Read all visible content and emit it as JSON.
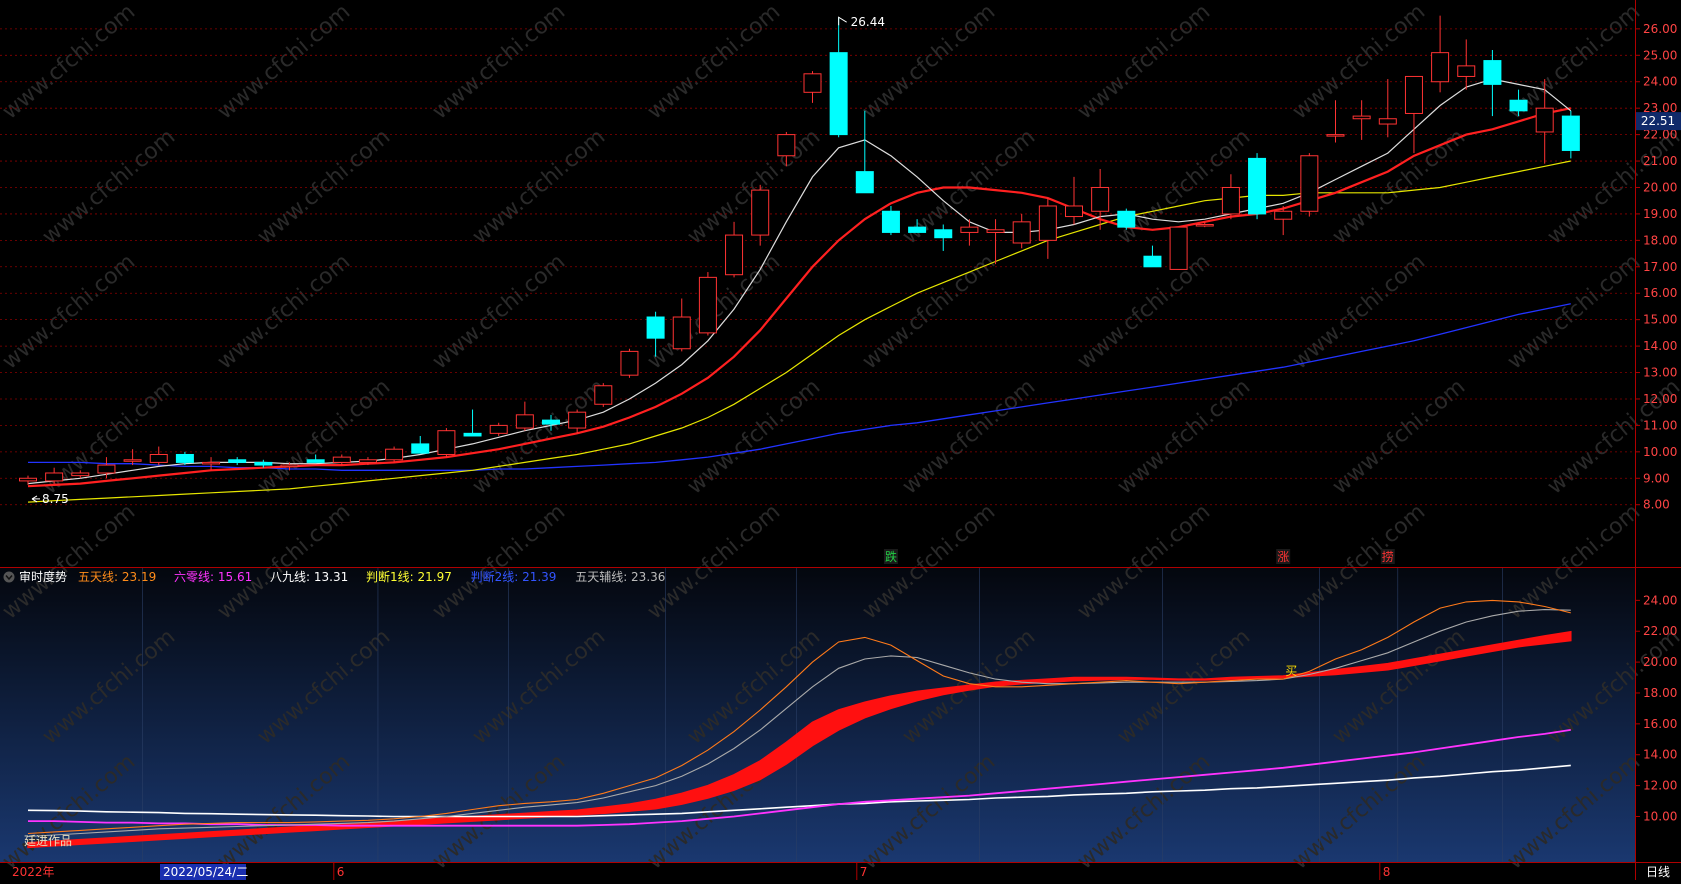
{
  "main_chart": {
    "price_high_label": "26.44",
    "price_low_label": "8.75",
    "current_price_label": "22.51",
    "y_ticks": [
      "26.00",
      "25.00",
      "24.00",
      "23.00",
      "22.00",
      "21.00",
      "20.00",
      "19.00",
      "18.00",
      "17.00",
      "16.00",
      "15.00",
      "14.00",
      "13.00",
      "12.00",
      "11.00",
      "10.00",
      "9.00",
      "8.00"
    ],
    "signals": [
      {
        "text": "跌",
        "color": "#22cc44",
        "index": 33
      },
      {
        "text": "涨",
        "color": "#ff3333",
        "index": 48
      },
      {
        "text": "捞",
        "color": "#ff3333",
        "index": 52
      }
    ]
  },
  "indicator": {
    "title": "审时度势",
    "legend": [
      {
        "label": "五天线: 23.19",
        "color": "#ff8c1a"
      },
      {
        "label": "六零线: 15.61",
        "color": "#ff33ff"
      },
      {
        "label": "八九线: 13.31",
        "color": "#ffffff"
      },
      {
        "label": "判断1线: 21.97",
        "color": "#ffff33"
      },
      {
        "label": "判断2线: 21.39",
        "color": "#3355ff"
      },
      {
        "label": "五天辅线: 23.36",
        "color": "#bbbbbb"
      }
    ],
    "y_ticks": [
      "24.00",
      "22.00",
      "20.00",
      "18.00",
      "16.00",
      "14.00",
      "12.00",
      "10.00"
    ],
    "buy_label": "买",
    "author_label": "廷进作品"
  },
  "bottom_bar": {
    "year": "2022年",
    "date_box": "2022/05/24/二",
    "month_labels": [
      "6",
      "7",
      "8"
    ],
    "period_label": "日线"
  },
  "watermark": "www.cfchi.com",
  "colors": {
    "up": "#ff3333",
    "down": "#00ffff",
    "grid": "#8b0000",
    "axis_text": "#ff4444",
    "ma5": "#dddddd",
    "ma10": "#ff2020",
    "ma20": "#e6e600",
    "ma60": "#2233ff"
  },
  "chart_data": [
    {
      "type": "candlestick",
      "ylim": [
        7.8,
        26.6
      ],
      "candles": [
        {
          "o": 8.9,
          "h": 9.1,
          "l": 8.75,
          "c": 9.0
        },
        {
          "o": 8.9,
          "h": 9.4,
          "l": 8.8,
          "c": 9.2
        },
        {
          "o": 9.1,
          "h": 9.3,
          "l": 9.0,
          "c": 9.2
        },
        {
          "o": 9.2,
          "h": 9.8,
          "l": 9.0,
          "c": 9.5
        },
        {
          "o": 9.7,
          "h": 10.1,
          "l": 9.5,
          "c": 9.7
        },
        {
          "o": 9.6,
          "h": 10.2,
          "l": 9.5,
          "c": 9.9
        },
        {
          "o": 9.9,
          "h": 10.0,
          "l": 9.5,
          "c": 9.6
        },
        {
          "o": 9.6,
          "h": 9.8,
          "l": 9.3,
          "c": 9.6
        },
        {
          "o": 9.7,
          "h": 9.8,
          "l": 9.5,
          "c": 9.6
        },
        {
          "o": 9.6,
          "h": 9.7,
          "l": 9.4,
          "c": 9.5
        },
        {
          "o": 9.5,
          "h": 9.6,
          "l": 9.3,
          "c": 9.5
        },
        {
          "o": 9.7,
          "h": 9.9,
          "l": 9.6,
          "c": 9.6
        },
        {
          "o": 9.6,
          "h": 9.9,
          "l": 9.5,
          "c": 9.8
        },
        {
          "o": 9.6,
          "h": 9.8,
          "l": 9.5,
          "c": 9.7
        },
        {
          "o": 9.7,
          "h": 10.2,
          "l": 9.6,
          "c": 10.1
        },
        {
          "o": 10.3,
          "h": 10.6,
          "l": 10.0,
          "c": 9.95
        },
        {
          "o": 9.9,
          "h": 10.9,
          "l": 9.8,
          "c": 10.8
        },
        {
          "o": 10.7,
          "h": 11.6,
          "l": 10.6,
          "c": 10.6
        },
        {
          "o": 10.7,
          "h": 11.1,
          "l": 10.6,
          "c": 11.0
        },
        {
          "o": 10.9,
          "h": 11.9,
          "l": 10.8,
          "c": 11.4
        },
        {
          "o": 11.2,
          "h": 11.4,
          "l": 10.8,
          "c": 11.05
        },
        {
          "o": 10.9,
          "h": 11.6,
          "l": 10.7,
          "c": 11.5
        },
        {
          "o": 11.8,
          "h": 12.6,
          "l": 11.7,
          "c": 12.5
        },
        {
          "o": 12.9,
          "h": 13.9,
          "l": 12.8,
          "c": 13.8
        },
        {
          "o": 15.1,
          "h": 15.3,
          "l": 13.6,
          "c": 14.3
        },
        {
          "o": 13.9,
          "h": 15.8,
          "l": 13.8,
          "c": 15.1
        },
        {
          "o": 14.5,
          "h": 16.8,
          "l": 14.4,
          "c": 16.6
        },
        {
          "o": 16.7,
          "h": 18.7,
          "l": 16.6,
          "c": 18.2
        },
        {
          "o": 18.2,
          "h": 20.1,
          "l": 17.8,
          "c": 19.9
        },
        {
          "o": 21.2,
          "h": 22.1,
          "l": 20.8,
          "c": 22.0
        },
        {
          "o": 23.6,
          "h": 24.4,
          "l": 23.2,
          "c": 24.3
        },
        {
          "o": 25.1,
          "h": 26.44,
          "l": 21.9,
          "c": 22.0
        },
        {
          "o": 20.6,
          "h": 22.9,
          "l": 19.8,
          "c": 19.8
        },
        {
          "o": 19.1,
          "h": 19.3,
          "l": 18.2,
          "c": 18.3
        },
        {
          "o": 18.5,
          "h": 18.8,
          "l": 18.3,
          "c": 18.3
        },
        {
          "o": 18.4,
          "h": 18.6,
          "l": 17.6,
          "c": 18.1
        },
        {
          "o": 18.3,
          "h": 18.8,
          "l": 17.8,
          "c": 18.5
        },
        {
          "o": 18.3,
          "h": 18.8,
          "l": 17.1,
          "c": 18.4
        },
        {
          "o": 17.9,
          "h": 19.0,
          "l": 17.7,
          "c": 18.7
        },
        {
          "o": 18.0,
          "h": 19.6,
          "l": 17.3,
          "c": 19.3
        },
        {
          "o": 18.9,
          "h": 20.4,
          "l": 18.6,
          "c": 19.3
        },
        {
          "o": 19.1,
          "h": 20.7,
          "l": 18.4,
          "c": 20.0
        },
        {
          "o": 19.1,
          "h": 19.2,
          "l": 18.4,
          "c": 18.5
        },
        {
          "o": 17.4,
          "h": 17.8,
          "l": 17.0,
          "c": 17.0
        },
        {
          "o": 16.9,
          "h": 18.5,
          "l": 16.9,
          "c": 18.5
        },
        {
          "o": 18.6,
          "h": 18.7,
          "l": 18.5,
          "c": 18.6
        },
        {
          "o": 19.0,
          "h": 20.5,
          "l": 18.8,
          "c": 20.0
        },
        {
          "o": 21.1,
          "h": 21.3,
          "l": 18.8,
          "c": 19.0
        },
        {
          "o": 18.8,
          "h": 19.3,
          "l": 18.2,
          "c": 19.1
        },
        {
          "o": 19.1,
          "h": 21.3,
          "l": 18.9,
          "c": 21.2
        },
        {
          "o": 22.0,
          "h": 23.3,
          "l": 21.7,
          "c": 22.0
        },
        {
          "o": 22.6,
          "h": 23.3,
          "l": 21.8,
          "c": 22.7
        },
        {
          "o": 22.4,
          "h": 24.1,
          "l": 21.9,
          "c": 22.6
        },
        {
          "o": 22.8,
          "h": 23.9,
          "l": 21.3,
          "c": 24.2
        },
        {
          "o": 24.0,
          "h": 26.5,
          "l": 23.6,
          "c": 25.1
        },
        {
          "o": 24.2,
          "h": 25.6,
          "l": 23.7,
          "c": 24.6
        },
        {
          "o": 24.8,
          "h": 25.2,
          "l": 22.7,
          "c": 23.9
        },
        {
          "o": 23.3,
          "h": 23.7,
          "l": 22.7,
          "c": 22.9
        },
        {
          "o": 22.1,
          "h": 24.1,
          "l": 20.9,
          "c": 23.0
        },
        {
          "o": 22.7,
          "h": 22.9,
          "l": 21.1,
          "c": 21.4
        }
      ],
      "ma5": [
        8.8,
        8.9,
        9.0,
        9.15,
        9.3,
        9.45,
        9.55,
        9.6,
        9.6,
        9.6,
        9.55,
        9.55,
        9.6,
        9.65,
        9.75,
        9.9,
        10.1,
        10.3,
        10.55,
        10.8,
        11.0,
        11.2,
        11.5,
        12.0,
        12.6,
        13.3,
        14.2,
        15.4,
        16.9,
        18.7,
        20.4,
        21.5,
        21.8,
        21.2,
        20.4,
        19.5,
        18.7,
        18.3,
        18.3,
        18.4,
        18.6,
        18.9,
        19.0,
        18.8,
        18.7,
        18.8,
        19.0,
        19.2,
        19.4,
        19.8,
        20.3,
        20.8,
        21.3,
        22.2,
        23.1,
        23.8,
        24.1,
        23.9,
        23.7,
        22.9
      ],
      "ma10": [
        8.7,
        8.75,
        8.8,
        8.9,
        9.0,
        9.1,
        9.2,
        9.3,
        9.35,
        9.4,
        9.45,
        9.5,
        9.5,
        9.55,
        9.6,
        9.7,
        9.8,
        9.95,
        10.1,
        10.3,
        10.5,
        10.7,
        10.95,
        11.3,
        11.7,
        12.2,
        12.8,
        13.6,
        14.6,
        15.8,
        17.0,
        18.0,
        18.8,
        19.4,
        19.8,
        20.0,
        20.0,
        19.9,
        19.8,
        19.6,
        19.2,
        18.8,
        18.5,
        18.4,
        18.5,
        18.7,
        18.9,
        19.0,
        19.2,
        19.5,
        19.8,
        20.2,
        20.6,
        21.2,
        21.6,
        22.0,
        22.2,
        22.5,
        22.8,
        23.0
      ],
      "ma20": [
        8.1,
        8.15,
        8.2,
        8.25,
        8.3,
        8.35,
        8.4,
        8.45,
        8.5,
        8.55,
        8.6,
        8.7,
        8.8,
        8.9,
        9.0,
        9.1,
        9.2,
        9.3,
        9.45,
        9.6,
        9.75,
        9.9,
        10.1,
        10.3,
        10.6,
        10.9,
        11.3,
        11.8,
        12.4,
        13.0,
        13.7,
        14.4,
        15.0,
        15.5,
        16.0,
        16.4,
        16.8,
        17.2,
        17.6,
        18.0,
        18.3,
        18.6,
        18.9,
        19.1,
        19.3,
        19.5,
        19.6,
        19.7,
        19.7,
        19.8,
        19.8,
        19.8,
        19.8,
        19.9,
        20.0,
        20.2,
        20.4,
        20.6,
        20.8,
        21.0
      ],
      "ma60": [
        9.6,
        9.6,
        9.6,
        9.55,
        9.55,
        9.5,
        9.45,
        9.45,
        9.4,
        9.4,
        9.35,
        9.35,
        9.3,
        9.3,
        9.3,
        9.3,
        9.3,
        9.3,
        9.35,
        9.35,
        9.4,
        9.45,
        9.5,
        9.55,
        9.6,
        9.7,
        9.8,
        9.95,
        10.1,
        10.3,
        10.5,
        10.7,
        10.85,
        11.0,
        11.1,
        11.25,
        11.4,
        11.55,
        11.7,
        11.85,
        12.0,
        12.15,
        12.3,
        12.45,
        12.6,
        12.75,
        12.9,
        13.05,
        13.2,
        13.4,
        13.6,
        13.8,
        14.0,
        14.2,
        14.45,
        14.7,
        14.95,
        15.2,
        15.4,
        15.6
      ]
    },
    {
      "type": "line",
      "title": "审时度势",
      "ylim": [
        8.8,
        24.8
      ],
      "five_day_line": [
        8.9,
        9.0,
        9.1,
        9.2,
        9.3,
        9.4,
        9.5,
        9.55,
        9.6,
        9.6,
        9.6,
        9.65,
        9.7,
        9.75,
        9.85,
        10.0,
        10.2,
        10.45,
        10.7,
        10.85,
        10.95,
        11.1,
        11.5,
        12.0,
        12.5,
        13.3,
        14.3,
        15.5,
        16.9,
        18.4,
        20.0,
        21.3,
        21.6,
        21.1,
        20.1,
        19.1,
        18.6,
        18.4,
        18.4,
        18.5,
        18.6,
        18.7,
        18.8,
        18.7,
        18.6,
        18.7,
        18.8,
        18.9,
        18.9,
        19.4,
        20.2,
        20.8,
        21.6,
        22.6,
        23.5,
        23.9,
        24.0,
        23.9,
        23.6,
        23.19
      ],
      "five_day_aux": [
        8.7,
        8.8,
        8.9,
        9.0,
        9.1,
        9.2,
        9.25,
        9.3,
        9.35,
        9.4,
        9.45,
        9.5,
        9.55,
        9.6,
        9.7,
        9.85,
        10.0,
        10.2,
        10.4,
        10.6,
        10.75,
        10.9,
        11.2,
        11.6,
        12.0,
        12.6,
        13.4,
        14.4,
        15.6,
        17.0,
        18.4,
        19.6,
        20.2,
        20.4,
        20.3,
        19.8,
        19.3,
        18.9,
        18.7,
        18.6,
        18.6,
        18.65,
        18.7,
        18.7,
        18.7,
        18.7,
        18.75,
        18.8,
        18.9,
        19.2,
        19.6,
        20.1,
        20.6,
        21.3,
        22.0,
        22.6,
        23.0,
        23.3,
        23.4,
        23.36
      ],
      "judge1_line": [
        8.3,
        8.4,
        8.5,
        8.6,
        8.7,
        8.8,
        8.9,
        9.0,
        9.1,
        9.2,
        9.3,
        9.4,
        9.5,
        9.6,
        9.7,
        9.8,
        9.9,
        10.0,
        10.1,
        10.2,
        10.3,
        10.4,
        10.6,
        10.8,
        11.1,
        11.5,
        12.0,
        12.7,
        13.6,
        14.8,
        16.1,
        16.9,
        17.4,
        17.8,
        18.1,
        18.3,
        18.5,
        18.7,
        18.8,
        18.9,
        19.0,
        19.0,
        19.0,
        18.95,
        18.9,
        18.9,
        19.0,
        19.05,
        19.1,
        19.3,
        19.5,
        19.7,
        19.9,
        20.2,
        20.5,
        20.8,
        21.1,
        21.4,
        21.7,
        21.97
      ],
      "judge2_line": [
        8.0,
        8.1,
        8.2,
        8.3,
        8.4,
        8.5,
        8.6,
        8.7,
        8.8,
        8.9,
        9.0,
        9.1,
        9.2,
        9.3,
        9.4,
        9.5,
        9.6,
        9.7,
        9.8,
        9.9,
        10.0,
        10.1,
        10.2,
        10.35,
        10.5,
        10.8,
        11.2,
        11.7,
        12.4,
        13.4,
        14.6,
        15.6,
        16.4,
        17.0,
        17.5,
        17.9,
        18.2,
        18.45,
        18.6,
        18.7,
        18.8,
        18.85,
        18.9,
        18.9,
        18.85,
        18.85,
        18.9,
        18.95,
        19.0,
        19.1,
        19.2,
        19.35,
        19.5,
        19.8,
        20.1,
        20.4,
        20.7,
        21.0,
        21.2,
        21.39
      ],
      "sixty_line": [
        9.7,
        9.7,
        9.65,
        9.6,
        9.6,
        9.55,
        9.55,
        9.5,
        9.5,
        9.45,
        9.45,
        9.45,
        9.4,
        9.4,
        9.4,
        9.4,
        9.4,
        9.4,
        9.4,
        9.4,
        9.4,
        9.4,
        9.45,
        9.5,
        9.6,
        9.7,
        9.85,
        10.0,
        10.2,
        10.4,
        10.6,
        10.8,
        10.95,
        11.05,
        11.15,
        11.25,
        11.35,
        11.5,
        11.65,
        11.8,
        11.95,
        12.1,
        12.25,
        12.4,
        12.55,
        12.7,
        12.85,
        13.0,
        13.15,
        13.35,
        13.55,
        13.75,
        13.95,
        14.15,
        14.4,
        14.65,
        14.9,
        15.15,
        15.35,
        15.61
      ],
      "eighty_nine_line": [
        10.4,
        10.38,
        10.35,
        10.3,
        10.28,
        10.25,
        10.2,
        10.18,
        10.15,
        10.12,
        10.1,
        10.08,
        10.05,
        10.03,
        10.0,
        10.0,
        10.0,
        10.0,
        10.0,
        10.0,
        10.0,
        10.0,
        10.05,
        10.1,
        10.15,
        10.2,
        10.3,
        10.4,
        10.5,
        10.6,
        10.7,
        10.8,
        10.85,
        10.95,
        11.0,
        11.05,
        11.1,
        11.2,
        11.25,
        11.3,
        11.4,
        11.45,
        11.5,
        11.6,
        11.65,
        11.7,
        11.8,
        11.85,
        11.95,
        12.05,
        12.15,
        12.25,
        12.35,
        12.5,
        12.6,
        12.75,
        12.9,
        13.0,
        13.15,
        13.31
      ]
    }
  ]
}
